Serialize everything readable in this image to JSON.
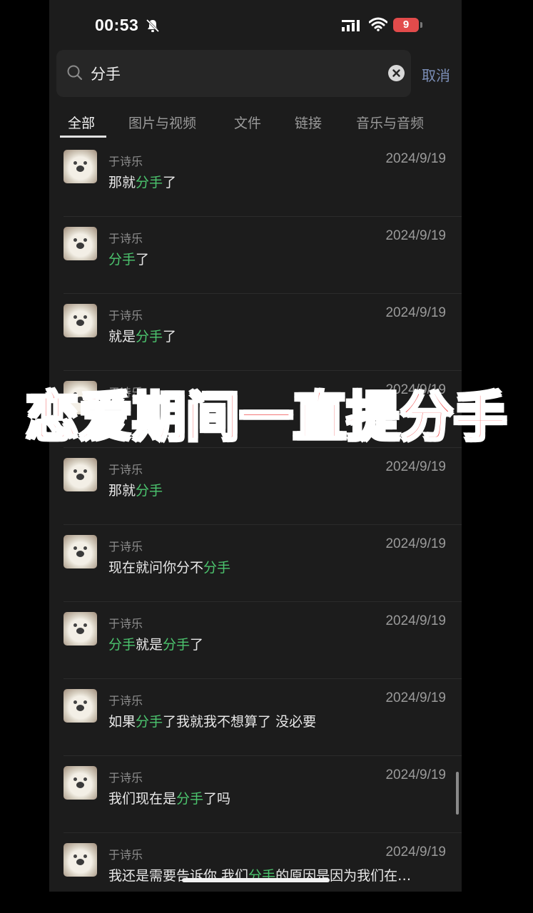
{
  "status_bar": {
    "time": "00:53",
    "battery": "9",
    "icons": [
      "bell-muted-icon",
      "signal-icon",
      "wifi-icon",
      "battery-icon"
    ]
  },
  "search": {
    "query": "分手",
    "cancel_label": "取消"
  },
  "tabs": [
    {
      "label": "全部",
      "active": true
    },
    {
      "label": "图片与视频",
      "active": false
    },
    {
      "label": "文件",
      "active": false
    },
    {
      "label": "链接",
      "active": false
    },
    {
      "label": "音乐与音频",
      "active": false
    }
  ],
  "results": [
    {
      "name": "于诗乐",
      "date": "2024/9/19",
      "parts": [
        {
          "t": "那就"
        },
        {
          "t": "分手",
          "h": true
        },
        {
          "t": "了"
        }
      ]
    },
    {
      "name": "于诗乐",
      "date": "2024/9/19",
      "parts": [
        {
          "t": "分手",
          "h": true
        },
        {
          "t": "了"
        }
      ]
    },
    {
      "name": "于诗乐",
      "date": "2024/9/19",
      "parts": [
        {
          "t": "就是"
        },
        {
          "t": "分手",
          "h": true
        },
        {
          "t": "了"
        }
      ]
    },
    {
      "name": "于诗乐",
      "date": "2024/9/19",
      "parts": []
    },
    {
      "name": "于诗乐",
      "date": "2024/9/19",
      "parts": [
        {
          "t": "那就"
        },
        {
          "t": "分手",
          "h": true
        }
      ]
    },
    {
      "name": "于诗乐",
      "date": "2024/9/19",
      "parts": [
        {
          "t": "现在就问你分不"
        },
        {
          "t": "分手",
          "h": true
        }
      ]
    },
    {
      "name": "于诗乐",
      "date": "2024/9/19",
      "parts": [
        {
          "t": "分手",
          "h": true
        },
        {
          "t": "就是"
        },
        {
          "t": "分手",
          "h": true
        },
        {
          "t": "了"
        }
      ]
    },
    {
      "name": "于诗乐",
      "date": "2024/9/19",
      "parts": [
        {
          "t": "如果"
        },
        {
          "t": "分手",
          "h": true
        },
        {
          "t": "了我就我不想算了 没必要"
        }
      ]
    },
    {
      "name": "于诗乐",
      "date": "2024/9/19",
      "parts": [
        {
          "t": "我们现在是"
        },
        {
          "t": "分手",
          "h": true
        },
        {
          "t": "了吗"
        }
      ]
    },
    {
      "name": "于诗乐",
      "date": "2024/9/19",
      "parts": [
        {
          "t": "我还是需要告诉你 我们"
        },
        {
          "t": "分手",
          "h": true
        },
        {
          "t": "的原因是因为我们在…"
        }
      ]
    }
  ],
  "overlay_caption": "恋爱期间一直提分手",
  "colors": {
    "highlight": "#4cc46e",
    "overlay_text": "#ee3d3d",
    "cancel_link": "#7c8fb8"
  }
}
